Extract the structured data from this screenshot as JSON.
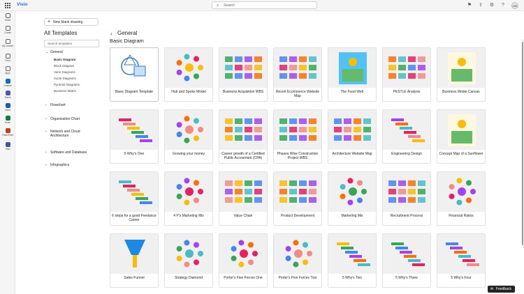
{
  "app": {
    "name": "Visio"
  },
  "search": {
    "placeholder": "Search"
  },
  "user": {
    "initials": "HM"
  },
  "rail": [
    {
      "label": "Home",
      "color": "#616161",
      "icon": "home-icon"
    },
    {
      "label": "Create",
      "color": "#616161",
      "icon": "create-icon"
    },
    {
      "label": "My Content",
      "color": "#616161",
      "icon": "folder-icon"
    },
    {
      "label": "Feed",
      "color": "#616161",
      "icon": "feed-icon"
    },
    {
      "label": "Apps",
      "color": "#616161",
      "icon": "apps-icon"
    },
    {
      "label": "Outlook",
      "color": "#0f6cbd",
      "icon": "outlook-icon"
    },
    {
      "label": "Teams",
      "color": "#4b53bc",
      "icon": "teams-icon"
    },
    {
      "label": "Word",
      "color": "#185abd",
      "icon": "word-icon"
    },
    {
      "label": "Excel",
      "color": "#107c41",
      "icon": "excel-icon"
    },
    {
      "label": "PowerPoint",
      "color": "#c43e1c",
      "icon": "powerpoint-icon"
    },
    {
      "label": "Visio",
      "color": "#3955a3",
      "icon": "visio-icon"
    }
  ],
  "panel": {
    "new_button": "New blank drawing",
    "title": "All Templates",
    "search_placeholder": "Search templates",
    "categories": [
      {
        "label": "General",
        "expanded": true,
        "items": [
          "Basic Diagram",
          "Block Diagram",
          "Venn Diagrams",
          "Cycle Diagrams",
          "Pyramid Diagrams",
          "Business Matrix"
        ]
      },
      {
        "label": "Flowchart"
      },
      {
        "label": "Organization Chart"
      },
      {
        "label": "Network and Cloud Architecture"
      },
      {
        "label": "Software and Database"
      },
      {
        "label": "Infographics"
      }
    ]
  },
  "main": {
    "breadcrumb": "General",
    "section_title": "Basic Diagram",
    "templates": [
      "Basic Diagram Template",
      "Hub and Spoke Model",
      "Business Acquisition WBS",
      "Resort Ecommerce Website Map",
      "The Food Web",
      "PESTLE Analysis",
      "Business Model Canvas",
      "5 Why's One",
      "Growing your money",
      "Career growth of a Certified Public Accountant (CPA)",
      "Phases Wise Construction Project WBS",
      "Architecture Website Map",
      "Engineering Design",
      "Concept Map of a Sunflower",
      "6 steps for a good Freelance Career",
      "4 P's Marketing Mix",
      "Value Chain",
      "Product Development",
      "Marketing Mix",
      "Recruitment Process",
      "Financial Ratios",
      "Sales Funnel",
      "Strategy Diamond",
      "Porter's Five Forces One",
      "Porter's Five Forces Two",
      "5 Why's Two",
      "5 Why's Three",
      "5 Why's Four"
    ]
  },
  "feedback": "Feedback"
}
